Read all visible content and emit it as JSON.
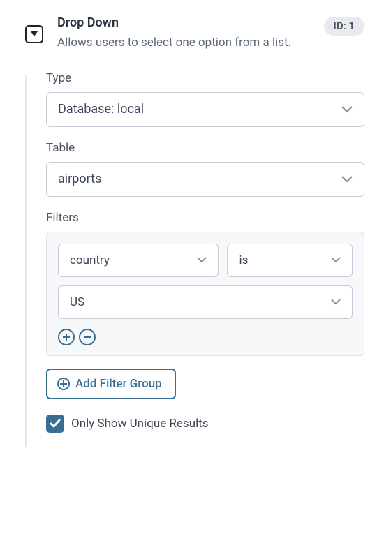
{
  "header": {
    "title": "Drop Down",
    "description": "Allows users to select one option from a list.",
    "id_badge": "ID: 1"
  },
  "fields": {
    "type": {
      "label": "Type",
      "value": "Database: local"
    },
    "table": {
      "label": "Table",
      "value": "airports"
    }
  },
  "filters": {
    "label": "Filters",
    "group": {
      "column_value": "country",
      "operator_value": "is",
      "value_value": "US"
    },
    "add_group_label": "Add Filter Group"
  },
  "unique": {
    "label": "Only Show Unique Results",
    "checked": true
  }
}
